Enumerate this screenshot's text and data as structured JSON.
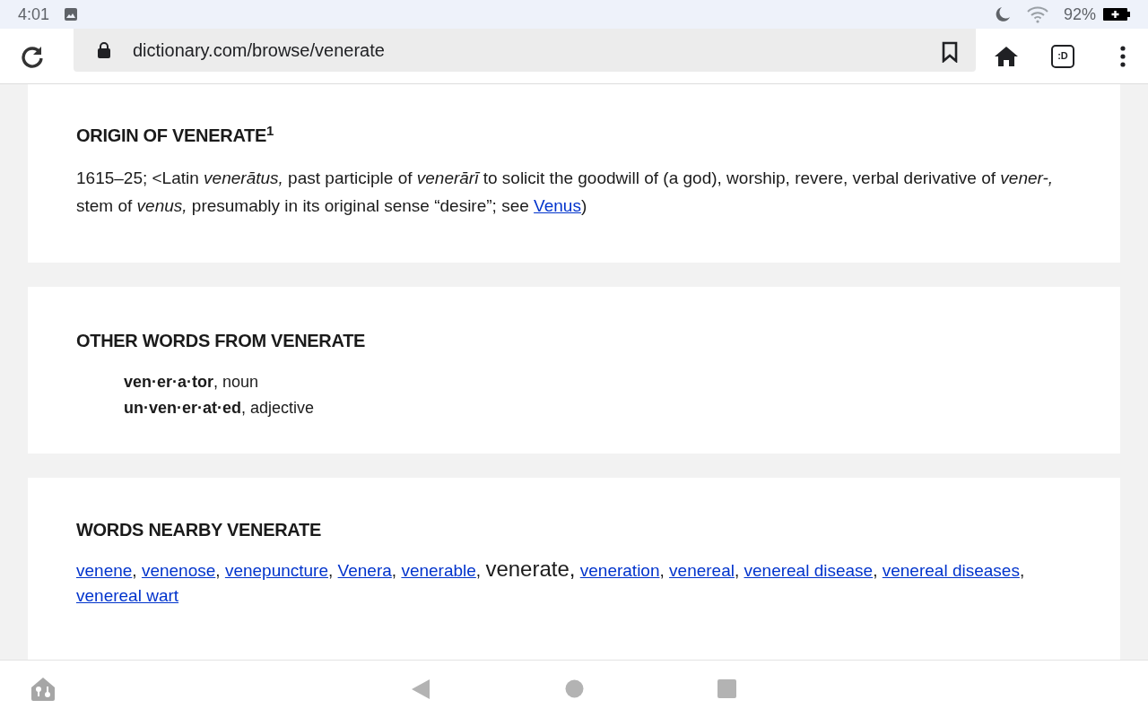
{
  "status_bar": {
    "time": "4:01",
    "battery": "92%"
  },
  "browser": {
    "url": "dictionary.com/browse/venerate",
    "tab_button": ":D"
  },
  "origin": {
    "heading": "ORIGIN OF VENERATE$^{1}$",
    "text_before": "1615–25; <Latin *venerātus,* past participle of *venerārī* to solicit the goodwill of (a god), worship, revere, verbal derivative of *vener-,* stem of *venus,* presumably in its original sense “desire”; see ",
    "link": "Venus",
    "text_after": ")"
  },
  "other_words": {
    "heading": "OTHER WORDS FROM VENERATE",
    "items": [
      "**ven·er·a·tor**, noun",
      "**un·ven·er·at·ed**, adjective"
    ]
  },
  "nearby": {
    "heading": "WORDS NEARBY VENERATE",
    "separator": ",",
    "items": [
      {
        "word": "venene",
        "kind": "link"
      },
      {
        "word": "venenose",
        "kind": "link"
      },
      {
        "word": "venepuncture",
        "kind": "link"
      },
      {
        "word": "Venera",
        "kind": "link"
      },
      {
        "word": "venerable",
        "kind": "link"
      },
      {
        "word": "venerate",
        "kind": "current"
      },
      {
        "word": "veneration",
        "kind": "link"
      },
      {
        "word": "venereal",
        "kind": "link"
      },
      {
        "word": "venereal disease",
        "kind": "link"
      },
      {
        "word": "venereal diseases",
        "kind": "link"
      },
      {
        "word": "venereal wart",
        "kind": "link"
      }
    ]
  }
}
